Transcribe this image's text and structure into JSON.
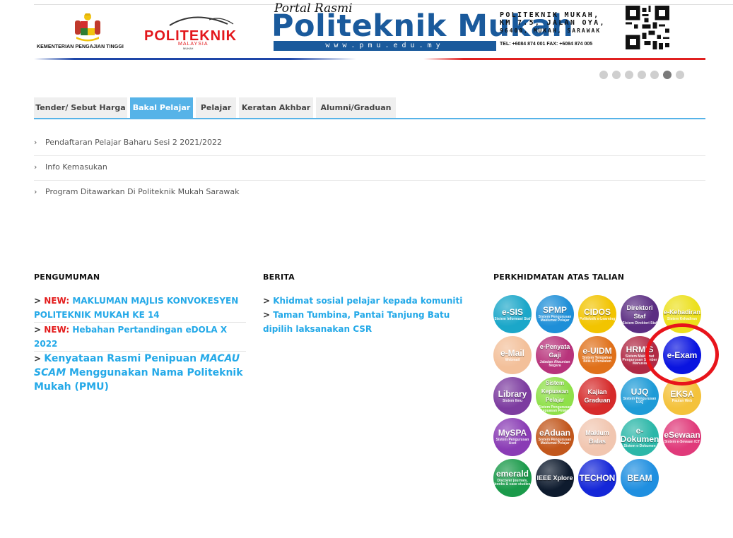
{
  "header": {
    "ministry": "KEMENTERIAN PENGAJIAN TINGGI",
    "logo_word": "POLITEKNIK",
    "logo_sub": "MALAYSIA",
    "logo_sub2": "MUKAH",
    "portal_sub": "Portal Rasmi",
    "portal_title": "Politeknik Mukah",
    "url": "www.pmu.edu.my",
    "addr1": "POLITEKNIK MUKAH,",
    "addr2": "KM 7.5, JALAN OYA,",
    "addr3": "96400, MUKAH, SARAWAK",
    "tel": "TEL: +6084 874 001  FAX: +6084 874 005"
  },
  "slider": {
    "count": 7,
    "active": 6
  },
  "tabs": [
    {
      "label": "Tender/ Sebut Harga"
    },
    {
      "label": "Bakal Pelajar"
    },
    {
      "label": "Pelajar"
    },
    {
      "label": "Keratan Akhbar"
    },
    {
      "label": "Alumni/Graduan"
    }
  ],
  "tab_items": [
    {
      "label": "Pendaftaran Pelajar Baharu Sesi 2 2021/2022"
    },
    {
      "label": "Info Kemasukan"
    },
    {
      "label": "Program Ditawarkan Di Politeknik Mukah Sarawak"
    }
  ],
  "pengumuman": {
    "heading": "PENGUMUMAN",
    "items": [
      {
        "new": "NEW:",
        "text": "MAKLUMAN MAJLIS KONVOKESYEN POLITEKNIK MUKAH KE 14"
      },
      {
        "new": "NEW:",
        "text": "Hebahan Pertandingan eDOLA X 2022"
      },
      {
        "text1": "Kenyataan Rasmi Penipuan",
        "text_em": "MACAU SCAM",
        "text2": "Menggunakan Nama Politeknik Mukah (PMU)"
      }
    ]
  },
  "berita": {
    "heading": "BERITA",
    "items": [
      {
        "text": "Khidmat sosial pelajar kepada komuniti"
      },
      {
        "text": "Taman Tumbina, Pantai Tanjung Batu dipilih laksanakan CSR"
      }
    ]
  },
  "perkhidmatan": {
    "heading": "PERKHIDMATAN ATAS TALIAN",
    "services": [
      {
        "name": "e-SIS",
        "sub": "Sistem Informasi Staf",
        "color": "#1ba7c9"
      },
      {
        "name": "SPMP",
        "sub": "Sistem Pengurusan Maklumat Pelajar",
        "color": "#1e8fd8"
      },
      {
        "name": "CIDOS",
        "sub": "Politeknik e-Learning",
        "color": "#f2c400"
      },
      {
        "name": "Direktori Staf",
        "sub": "Sistem Direktori Staf",
        "color": "#5b2d82"
      },
      {
        "name": "e-Kehadiran",
        "sub": "Sistem Kehadiran",
        "color": "#ece01c"
      },
      {
        "name": "e-Mail",
        "sub": "Webmail",
        "color": "#f3c09a"
      },
      {
        "name": "e-Penyata Gaji",
        "sub": "Jabatan Akauntan Negara",
        "color": "#b8337b"
      },
      {
        "name": "e-UIDM",
        "sub": "Sistem Tempahan Bilik & Peralatan",
        "color": "#e0711a"
      },
      {
        "name": "HRMIS",
        "sub": "Sistem Maklumat Pengurusan Sumber Manusia",
        "color": "#b02a45"
      },
      {
        "name": "e-Exam",
        "sub": "",
        "color": "#0a14e0"
      },
      {
        "name": "Library",
        "sub": "Sistem Ilmu",
        "color": "#7d3ca0"
      },
      {
        "name": "Sistem Kepuasan Pelajar",
        "sub": "Sistem Pengurusan Kepuasan Pelajar",
        "color": "#8fe04a"
      },
      {
        "name": "Kajian Graduan",
        "sub": "",
        "color": "#d62b2b"
      },
      {
        "name": "UJQ",
        "sub": "Sistem Pengurusan UJQ",
        "color": "#1e9bd7"
      },
      {
        "name": "EKSA",
        "sub": "Pautan Web",
        "color": "#f4c23b"
      },
      {
        "name": "MySPA",
        "sub": "Sistem Pengurusan Aset",
        "color": "#8a3cb5"
      },
      {
        "name": "eAduan",
        "sub": "Sistem Pengurusan Maklumat Pelajar",
        "color": "#c2571c"
      },
      {
        "name": "Maklum Balas",
        "sub": "",
        "color": "#f1c6b0"
      },
      {
        "name": "e-Dokumen",
        "sub": "Sistem e-Dokumen",
        "color": "#2bb7a8"
      },
      {
        "name": "eSewaan",
        "sub": "Sistem e-Sewaan ICT",
        "color": "#e03a7a"
      },
      {
        "name": "emerald",
        "sub": "Discover journals, books & case studies",
        "color": "#1a9a4a"
      },
      {
        "name": "IEEE Xplore",
        "sub": "",
        "color": "#0e1b2e"
      },
      {
        "name": "TECHON",
        "sub": "",
        "color": "#1527d8"
      },
      {
        "name": "BEAM",
        "sub": "",
        "color": "#1f8fe0"
      }
    ]
  }
}
